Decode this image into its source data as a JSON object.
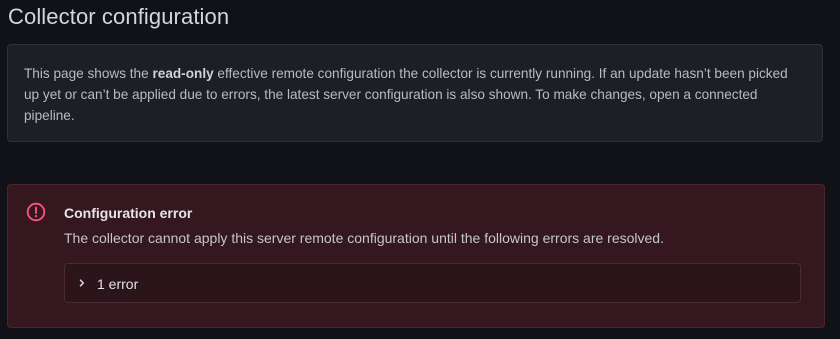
{
  "page": {
    "title": "Collector configuration"
  },
  "info": {
    "text_before": "This page shows the ",
    "bold": "read-only",
    "text_after": " effective remote configuration the collector is currently running. If an update hasn’t been picked up yet or can’t be applied due to errors, the latest server configuration is also shown. To make changes, open a connected pipeline."
  },
  "error_alert": {
    "icon": "alert-circle-icon",
    "title": "Configuration error",
    "description": "The collector cannot apply this server remote configuration until the following errors are resolved.",
    "toggle_icon": "chevron-right-icon",
    "toggle_label": "1 error"
  },
  "colors": {
    "background": "#111217",
    "panel": "#1e1f24",
    "error_panel": "#35171f",
    "error_accent": "#ff5286"
  }
}
